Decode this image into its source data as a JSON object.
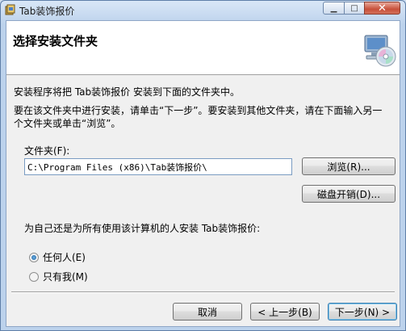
{
  "window": {
    "title": "Tab装饰报价",
    "minimize_glyph": "▁",
    "maximize_glyph": "□",
    "close_glyph": "✕"
  },
  "header": {
    "title": "选择安装文件夹",
    "icon": "cd-computer-icon"
  },
  "body": {
    "line1": "安装程序将把 Tab装饰报价 安装到下面的文件夹中。",
    "line2": "要在该文件夹中进行安装，请单击“下一步”。要安装到其他文件夹，请在下面输入另一",
    "line3": "个文件夹或单击“浏览”。"
  },
  "folder": {
    "label": "文件夹(F):",
    "value": "C:\\Program Files (x86)\\Tab装饰报价\\",
    "browse_label": "浏览(R)...",
    "disk_cost_label": "磁盘开销(D)..."
  },
  "install_for": {
    "question": "为自己还是为所有使用该计算机的人安装 Tab装饰报价:",
    "options": [
      {
        "label": "任何人(E)",
        "checked": true
      },
      {
        "label": "只有我(M)",
        "checked": false
      }
    ]
  },
  "footer": {
    "cancel_label": "取消",
    "back_label": "< 上一步(B)",
    "next_label": "下一步(N) >"
  }
}
